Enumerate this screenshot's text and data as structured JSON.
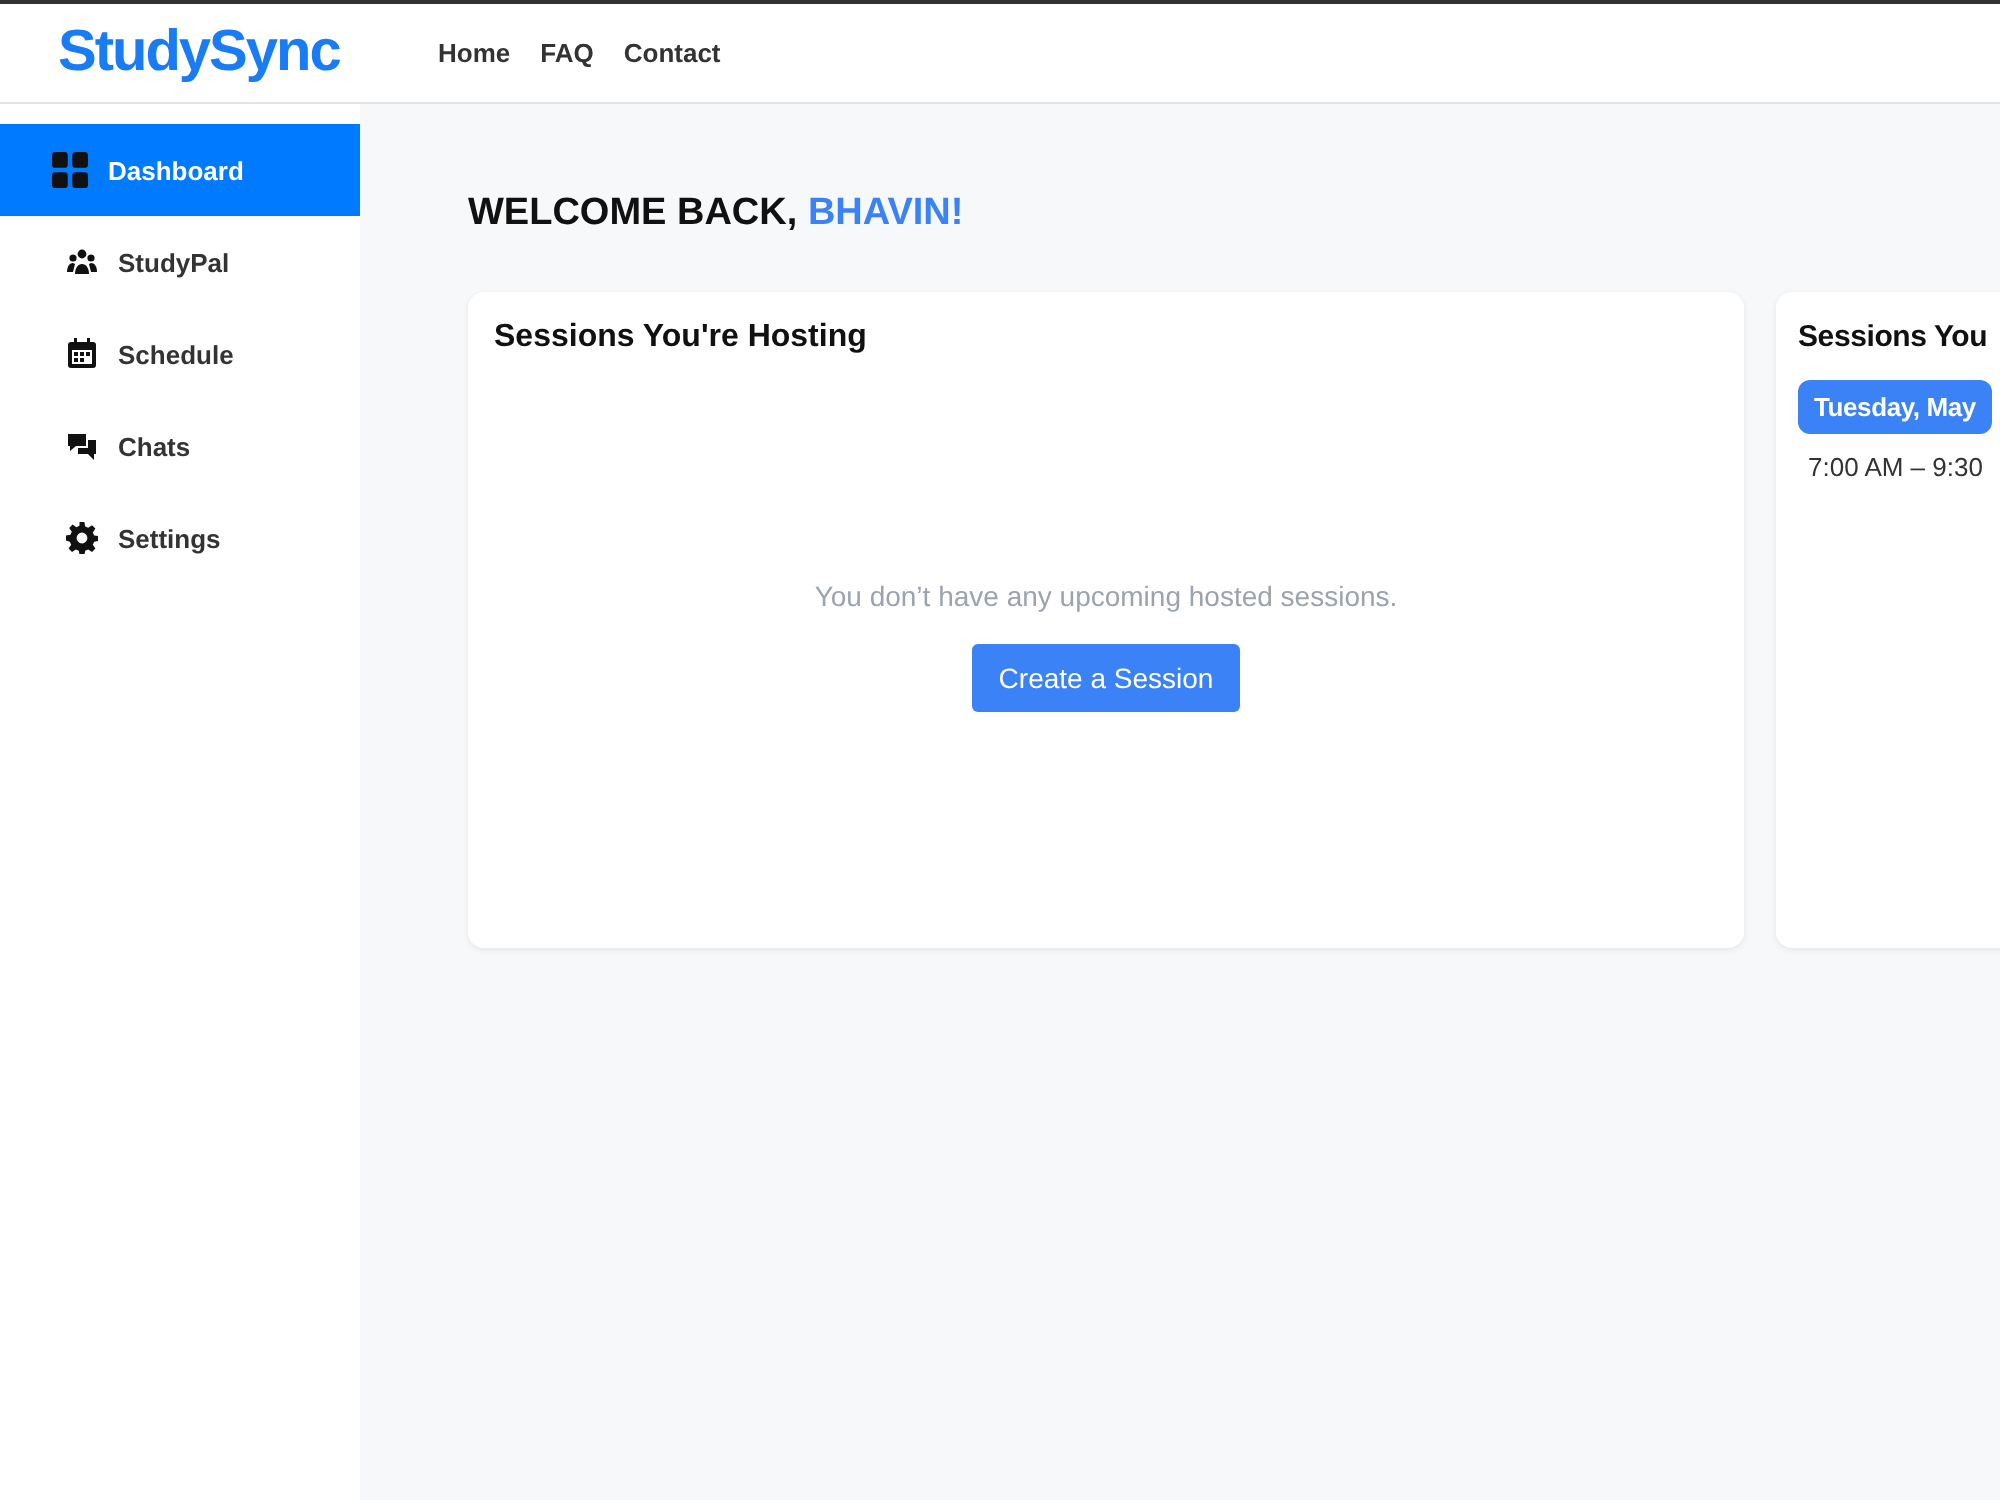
{
  "header": {
    "logo": "StudySync",
    "nav": [
      "Home",
      "FAQ",
      "Contact"
    ]
  },
  "sidebar": {
    "items": [
      {
        "label": "Dashboard",
        "kind": "grid",
        "selected": true
      },
      {
        "label": "StudyPal",
        "kind": "people",
        "selected": false
      },
      {
        "label": "Schedule",
        "kind": "calendar",
        "selected": false
      },
      {
        "label": "Chats",
        "kind": "chat",
        "selected": false
      },
      {
        "label": "Settings",
        "kind": "gear",
        "selected": false
      }
    ]
  },
  "welcome": {
    "greeting": "WELCOME BACK,",
    "name": "BHAVIN!"
  },
  "hosting": {
    "title": "Sessions You're Hosting",
    "empty_message": "You don’t have any upcoming hosted sessions.",
    "button": "Create a Session"
  },
  "attending": {
    "title": "Sessions You",
    "date": "Tuesday, May",
    "time": "7:00 AM – 9:30"
  }
}
